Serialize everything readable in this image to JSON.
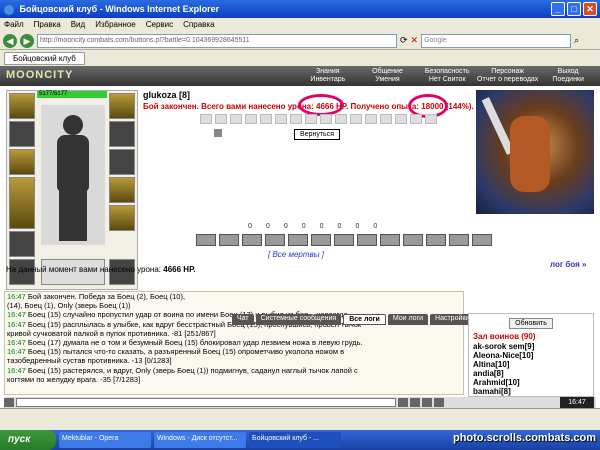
{
  "window": {
    "title": "Бойцовский клуб - Windows Internet Explorer"
  },
  "menu": [
    "Файл",
    "Правка",
    "Вид",
    "Избранное",
    "Сервис",
    "Справка"
  ],
  "address": {
    "url": "http://mooncity.combats.com/buttons.pl?battle=0.104369928645511",
    "search_placeholder": "Google"
  },
  "tab": {
    "label": "Бойцовский клуб"
  },
  "site": {
    "logo": "MOONCITY",
    "nav": [
      "Знания",
      "Общение",
      "Безопасность",
      "Персонаж",
      "Выход",
      "Инвентарь",
      "Умения",
      "Нет Свиток",
      "Отчет о переводах",
      "Поединки"
    ]
  },
  "character": {
    "name": "glukoza",
    "level": "[8]",
    "hp": "5177/5177"
  },
  "battle": {
    "result": "Бой закончен. Всего вами нанесено урона: 4666 HP. Получено опыта: 18000 (144%).",
    "return_label": "Вернуться",
    "stats": [
      "0",
      "0",
      "0",
      "0",
      "0",
      "0",
      "0",
      "0"
    ],
    "dead_link": "[ Все мертвы ]",
    "log_link": "лог боя »",
    "damage_text": "На данный момент вами нанесено урона:",
    "damage_value": "4666 HP."
  },
  "chat": {
    "lines": [
      {
        "time": "16:47",
        "text": "Бой закончен. Победа за Боец (2), Боец (10),"
      },
      {
        "time": "",
        "text": "(14), Боец (1), Only (зверь Боец (1))"
      },
      {
        "time": "16:47",
        "text": "Боец (15) случайно пропустил удар от воина по имени Боец (17) и выбил из боя... навсегда"
      },
      {
        "time": "16:47",
        "text": "Боец (15) расплылась в улыбке, как вдруг бесстрастный Боец (15), проснувшись, провел тычок"
      },
      {
        "time": "",
        "text": "кривой сучковатой палкой в пупок противника. -81 [251/867]"
      },
      {
        "time": "16:47",
        "text": "Боец (17) думала не о том и безумный Боец (15) блокировал удар лезвием ножа в левую грудь."
      },
      {
        "time": "16:47",
        "text": "Боец (15) пытался что-то сказать, а разъяренный Боец (15) опрометчиво уколола ножом в"
      },
      {
        "time": "",
        "text": "тазобедренный сустав противника. -13 [0/1283]"
      },
      {
        "time": "16:47",
        "text": "Боец (15) растерялся, и вдруг, Only (зверь Боец (1)) подмигнув, саданул наглый тычок лапой с"
      },
      {
        "time": "",
        "text": "когтями по желудку врага. -35 [7/1283]"
      }
    ],
    "tabs": [
      "Чат",
      "Системные сообщения",
      "Все логи",
      "Мои логи",
      "Настройки"
    ]
  },
  "right_panel": {
    "refresh": "Обновить",
    "hall": "Зал воинов (90)",
    "players": [
      "ak-sorok sem[9]",
      "Aleona-Nice[10]",
      "Altina[10]",
      "andia[8]",
      "Arahmid[10]",
      "bamahi[8]"
    ]
  },
  "clock": "16:47",
  "taskbar": {
    "start": "пуск",
    "items": [
      "Mektublar - Opera",
      "Windows - Диск отсутст...",
      "Бойцовский клуб - ..."
    ]
  },
  "watermark": "photo.scrolls.combats.com"
}
